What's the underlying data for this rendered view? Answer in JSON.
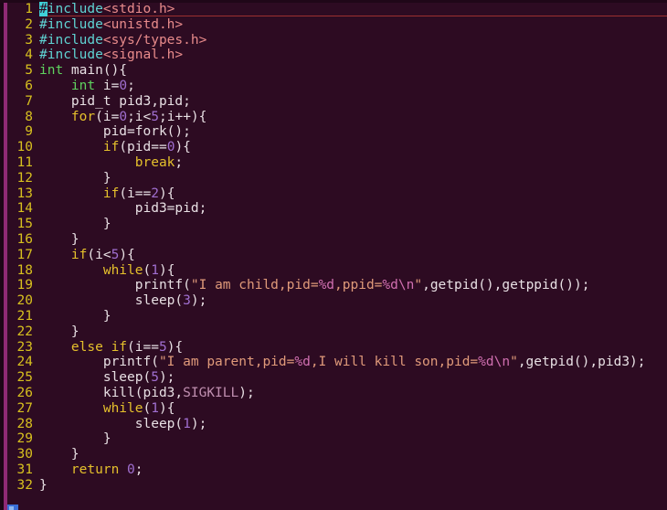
{
  "app": {
    "type": "terminal-text-editor",
    "editor": "vim",
    "mode": "normal"
  },
  "theme": {
    "background": "#2d0b22",
    "foreground": "#e8e0e4",
    "line_number": "#d7c01f",
    "accent_stripe": "#8f2a75",
    "cursor": "#3fd0d8",
    "cursorline_underline": "#9c3030",
    "preprocessor": "#5fd3d3",
    "header": "#e88b8b",
    "type": "#5fd35f",
    "keyword": "#e5c02c",
    "number": "#a06fd0",
    "string": "#e09a7a",
    "format_spec": "#d06fb0",
    "constant": "#c08fb0"
  },
  "editor": {
    "cursor_line": 1,
    "cursor_column": 1,
    "total_lines": 32,
    "gutter_width_chars": 2
  },
  "lines": [
    {
      "num": "1",
      "cursorline": true,
      "tokens": [
        {
          "text": "#",
          "cls": "t-pre cursor-block"
        },
        {
          "text": "include",
          "cls": "t-pre"
        },
        {
          "text": "<stdio.h>",
          "cls": "t-hdr"
        }
      ]
    },
    {
      "num": "2",
      "cursorline": false,
      "tokens": [
        {
          "text": "#include",
          "cls": "t-pre"
        },
        {
          "text": "<unistd.h>",
          "cls": "t-hdr"
        }
      ]
    },
    {
      "num": "3",
      "cursorline": false,
      "tokens": [
        {
          "text": "#include",
          "cls": "t-pre"
        },
        {
          "text": "<sys/types.h>",
          "cls": "t-hdr"
        }
      ]
    },
    {
      "num": "4",
      "cursorline": false,
      "tokens": [
        {
          "text": "#include",
          "cls": "t-pre"
        },
        {
          "text": "<signal.h>",
          "cls": "t-hdr"
        }
      ]
    },
    {
      "num": "5",
      "cursorline": false,
      "tokens": [
        {
          "text": "int",
          "cls": "t-type"
        },
        {
          "text": " main(){",
          "cls": "t-plain"
        }
      ]
    },
    {
      "num": "6",
      "cursorline": false,
      "tokens": [
        {
          "text": "    ",
          "cls": "t-plain"
        },
        {
          "text": "int",
          "cls": "t-type"
        },
        {
          "text": " i=",
          "cls": "t-plain"
        },
        {
          "text": "0",
          "cls": "t-num"
        },
        {
          "text": ";",
          "cls": "t-plain"
        }
      ]
    },
    {
      "num": "7",
      "cursorline": false,
      "tokens": [
        {
          "text": "    pid_t pid3,pid;",
          "cls": "t-plain"
        }
      ]
    },
    {
      "num": "8",
      "cursorline": false,
      "tokens": [
        {
          "text": "    ",
          "cls": "t-plain"
        },
        {
          "text": "for",
          "cls": "t-kw"
        },
        {
          "text": "(i=",
          "cls": "t-plain"
        },
        {
          "text": "0",
          "cls": "t-num"
        },
        {
          "text": ";i<",
          "cls": "t-plain"
        },
        {
          "text": "5",
          "cls": "t-num"
        },
        {
          "text": ";i++){",
          "cls": "t-plain"
        }
      ]
    },
    {
      "num": "9",
      "cursorline": false,
      "tokens": [
        {
          "text": "        pid=fork();",
          "cls": "t-plain"
        }
      ]
    },
    {
      "num": "10",
      "cursorline": false,
      "tokens": [
        {
          "text": "        ",
          "cls": "t-plain"
        },
        {
          "text": "if",
          "cls": "t-kw"
        },
        {
          "text": "(pid==",
          "cls": "t-plain"
        },
        {
          "text": "0",
          "cls": "t-num"
        },
        {
          "text": "){",
          "cls": "t-plain"
        }
      ]
    },
    {
      "num": "11",
      "cursorline": false,
      "tokens": [
        {
          "text": "            ",
          "cls": "t-plain"
        },
        {
          "text": "break",
          "cls": "t-kw"
        },
        {
          "text": ";",
          "cls": "t-plain"
        }
      ]
    },
    {
      "num": "12",
      "cursorline": false,
      "tokens": [
        {
          "text": "        }",
          "cls": "t-plain"
        }
      ]
    },
    {
      "num": "13",
      "cursorline": false,
      "tokens": [
        {
          "text": "        ",
          "cls": "t-plain"
        },
        {
          "text": "if",
          "cls": "t-kw"
        },
        {
          "text": "(i==",
          "cls": "t-plain"
        },
        {
          "text": "2",
          "cls": "t-num"
        },
        {
          "text": "){",
          "cls": "t-plain"
        }
      ]
    },
    {
      "num": "14",
      "cursorline": false,
      "tokens": [
        {
          "text": "            pid3=pid;",
          "cls": "t-plain"
        }
      ]
    },
    {
      "num": "15",
      "cursorline": false,
      "tokens": [
        {
          "text": "        }",
          "cls": "t-plain"
        }
      ]
    },
    {
      "num": "16",
      "cursorline": false,
      "tokens": [
        {
          "text": "    }",
          "cls": "t-plain"
        }
      ]
    },
    {
      "num": "17",
      "cursorline": false,
      "tokens": [
        {
          "text": "    ",
          "cls": "t-plain"
        },
        {
          "text": "if",
          "cls": "t-kw"
        },
        {
          "text": "(i<",
          "cls": "t-plain"
        },
        {
          "text": "5",
          "cls": "t-num"
        },
        {
          "text": "){",
          "cls": "t-plain"
        }
      ]
    },
    {
      "num": "18",
      "cursorline": false,
      "tokens": [
        {
          "text": "        ",
          "cls": "t-plain"
        },
        {
          "text": "while",
          "cls": "t-kw"
        },
        {
          "text": "(",
          "cls": "t-plain"
        },
        {
          "text": "1",
          "cls": "t-num"
        },
        {
          "text": "){",
          "cls": "t-plain"
        }
      ]
    },
    {
      "num": "19",
      "cursorline": false,
      "tokens": [
        {
          "text": "            printf(",
          "cls": "t-plain"
        },
        {
          "text": "\"I am child,pid=",
          "cls": "t-str"
        },
        {
          "text": "%d",
          "cls": "t-fmt"
        },
        {
          "text": ",ppid=",
          "cls": "t-str"
        },
        {
          "text": "%d",
          "cls": "t-fmt"
        },
        {
          "text": "\\n",
          "cls": "t-fmt"
        },
        {
          "text": "\"",
          "cls": "t-str"
        },
        {
          "text": ",getpid(),getppid());",
          "cls": "t-plain"
        }
      ]
    },
    {
      "num": "20",
      "cursorline": false,
      "tokens": [
        {
          "text": "            sleep(",
          "cls": "t-plain"
        },
        {
          "text": "3",
          "cls": "t-num"
        },
        {
          "text": ");",
          "cls": "t-plain"
        }
      ]
    },
    {
      "num": "21",
      "cursorline": false,
      "tokens": [
        {
          "text": "        }",
          "cls": "t-plain"
        }
      ]
    },
    {
      "num": "22",
      "cursorline": false,
      "tokens": [
        {
          "text": "    }",
          "cls": "t-plain"
        }
      ]
    },
    {
      "num": "23",
      "cursorline": false,
      "tokens": [
        {
          "text": "    ",
          "cls": "t-plain"
        },
        {
          "text": "else",
          "cls": "t-kw"
        },
        {
          "text": " ",
          "cls": "t-plain"
        },
        {
          "text": "if",
          "cls": "t-kw"
        },
        {
          "text": "(i==",
          "cls": "t-plain"
        },
        {
          "text": "5",
          "cls": "t-num"
        },
        {
          "text": "){",
          "cls": "t-plain"
        }
      ]
    },
    {
      "num": "24",
      "cursorline": false,
      "tokens": [
        {
          "text": "        printf(",
          "cls": "t-plain"
        },
        {
          "text": "\"I am parent,pid=",
          "cls": "t-str"
        },
        {
          "text": "%d",
          "cls": "t-fmt"
        },
        {
          "text": ",I will kill son,pid=",
          "cls": "t-str"
        },
        {
          "text": "%d",
          "cls": "t-fmt"
        },
        {
          "text": "\\n",
          "cls": "t-fmt"
        },
        {
          "text": "\"",
          "cls": "t-str"
        },
        {
          "text": ",getpid(),pid3);",
          "cls": "t-plain"
        }
      ]
    },
    {
      "num": "25",
      "cursorline": false,
      "tokens": [
        {
          "text": "        sleep(",
          "cls": "t-plain"
        },
        {
          "text": "5",
          "cls": "t-num"
        },
        {
          "text": ");",
          "cls": "t-plain"
        }
      ]
    },
    {
      "num": "26",
      "cursorline": false,
      "tokens": [
        {
          "text": "        kill(pid3,",
          "cls": "t-plain"
        },
        {
          "text": "SIGKILL",
          "cls": "t-const"
        },
        {
          "text": ");",
          "cls": "t-plain"
        }
      ]
    },
    {
      "num": "27",
      "cursorline": false,
      "tokens": [
        {
          "text": "        ",
          "cls": "t-plain"
        },
        {
          "text": "while",
          "cls": "t-kw"
        },
        {
          "text": "(",
          "cls": "t-plain"
        },
        {
          "text": "1",
          "cls": "t-num"
        },
        {
          "text": "){",
          "cls": "t-plain"
        }
      ]
    },
    {
      "num": "28",
      "cursorline": false,
      "tokens": [
        {
          "text": "            sleep(",
          "cls": "t-plain"
        },
        {
          "text": "1",
          "cls": "t-num"
        },
        {
          "text": ");",
          "cls": "t-plain"
        }
      ]
    },
    {
      "num": "29",
      "cursorline": false,
      "tokens": [
        {
          "text": "        }",
          "cls": "t-plain"
        }
      ]
    },
    {
      "num": "30",
      "cursorline": false,
      "tokens": [
        {
          "text": "    }",
          "cls": "t-plain"
        }
      ]
    },
    {
      "num": "31",
      "cursorline": false,
      "tokens": [
        {
          "text": "    ",
          "cls": "t-plain"
        },
        {
          "text": "return",
          "cls": "t-kw"
        },
        {
          "text": " ",
          "cls": "t-plain"
        },
        {
          "text": "0",
          "cls": "t-num"
        },
        {
          "text": ";",
          "cls": "t-plain"
        }
      ]
    },
    {
      "num": "32",
      "cursorline": false,
      "tokens": [
        {
          "text": "}",
          "cls": "t-plain"
        }
      ]
    }
  ]
}
